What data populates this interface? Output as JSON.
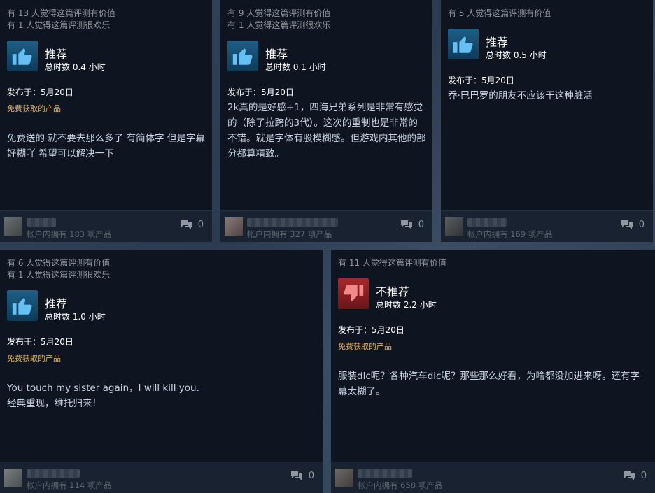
{
  "reviews": [
    {
      "helpful": "有 13 人觉得这篇评测有价值",
      "funny": "有 1 人觉得这篇评测很欢乐",
      "verdict": "推荐",
      "hours": "总时数 0.4 小时",
      "posted": "发布于：5月20日",
      "free_tag": "免费获取的产品",
      "body": "免费送的 就不要去那么多了 有简体字 但是字幕好糊吖 希望可以解决一下",
      "owned": "帐户内拥有 183 项产品",
      "comments": "0",
      "thumb_icon": "thumbs-up-icon"
    },
    {
      "helpful": "有 9 人觉得这篇评测有价值",
      "funny": "有 1 人觉得这篇评测很欢乐",
      "verdict": "推荐",
      "hours": "总时数 0.1 小时",
      "posted": "发布于：5月20日",
      "free_tag": "",
      "body": "2k真的是好感+1，四海兄弟系列是非常有感觉的（除了拉跨的3代）。这次的重制也是非常的不错。就是字体有股模糊感。但游戏内其他的部分都算精致。",
      "owned": "帐户内拥有 327 项产品",
      "comments": "0",
      "thumb_icon": "thumbs-up-icon"
    },
    {
      "helpful": "有 5 人觉得这篇评测有价值",
      "funny": "",
      "verdict": "推荐",
      "hours": "总时数 0.5 小时",
      "posted": "发布于：5月20日",
      "free_tag": "",
      "body": "乔·巴巴罗的朋友不应该干这种脏活",
      "owned": "帐户内拥有 169 项产品",
      "comments": "0",
      "thumb_icon": "thumbs-up-icon"
    },
    {
      "helpful": "有 6 人觉得这篇评测有价值",
      "funny": "有 1 人觉得这篇评测很欢乐",
      "verdict": "推荐",
      "hours": "总时数 1.0 小时",
      "posted": "发布于：5月20日",
      "free_tag": "免费获取的产品",
      "body": "You touch my sister again，I will kill you.\n经典重现，维托归来！",
      "owned": "帐户内拥有 114 项产品",
      "comments": "0",
      "thumb_icon": "thumbs-up-icon"
    },
    {
      "helpful": "有 11 人觉得这篇评测有价值",
      "funny": "",
      "verdict": "不推荐",
      "hours": "总时数 2.2 小时",
      "posted": "发布于：5月20日",
      "free_tag": "免费获取的产品",
      "body": "服装dlc呢？各种汽车dlc呢？那些那么好看，为啥都没加进来呀。还有字幕太糊了。",
      "owned": "帐户内拥有 658 项产品",
      "comments": "0",
      "thumb_icon": "thumbs-down-icon"
    }
  ],
  "colors": {
    "card_bg": "#0f1520",
    "recommend_thumb": "#1d5f86",
    "not_recommend_thumb": "#a8282b",
    "free_tag": "#e4b15a"
  }
}
